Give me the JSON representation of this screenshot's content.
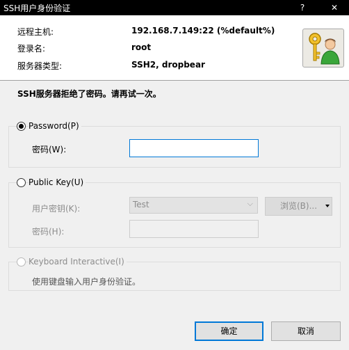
{
  "window": {
    "title": "SSH用户身份验证",
    "help_glyph": "?",
    "close_glyph": "✕"
  },
  "info": {
    "rows": [
      {
        "label": "远程主机:",
        "value": "192.168.7.149:22 (%default%)"
      },
      {
        "label": "登录名:",
        "value": "root"
      },
      {
        "label": "服务器类型:",
        "value": "SSH2, dropbear"
      }
    ],
    "icon": "key-user-icon"
  },
  "message": "SSH服务器拒绝了密码。请再试一次。",
  "password_method": {
    "label": "Password(P)",
    "selected": true,
    "field_label": "密码(W):",
    "value": ""
  },
  "publickey_method": {
    "label": "Public Key(U)",
    "selected": false,
    "key_label": "用户密钥(K):",
    "key_value": "Test",
    "browse_label": "浏览(B)...",
    "passphrase_label": "密码(H):",
    "passphrase_value": ""
  },
  "keyboard_method": {
    "label": "Keyboard Interactive(I)",
    "selected": false,
    "hint": "使用键盘输入用户身份验证。"
  },
  "buttons": {
    "ok": "确定",
    "cancel": "取消"
  },
  "colors": {
    "accent": "#0078d7",
    "titlebar": "#000000",
    "dialog_bg": "#f0f0f0"
  }
}
